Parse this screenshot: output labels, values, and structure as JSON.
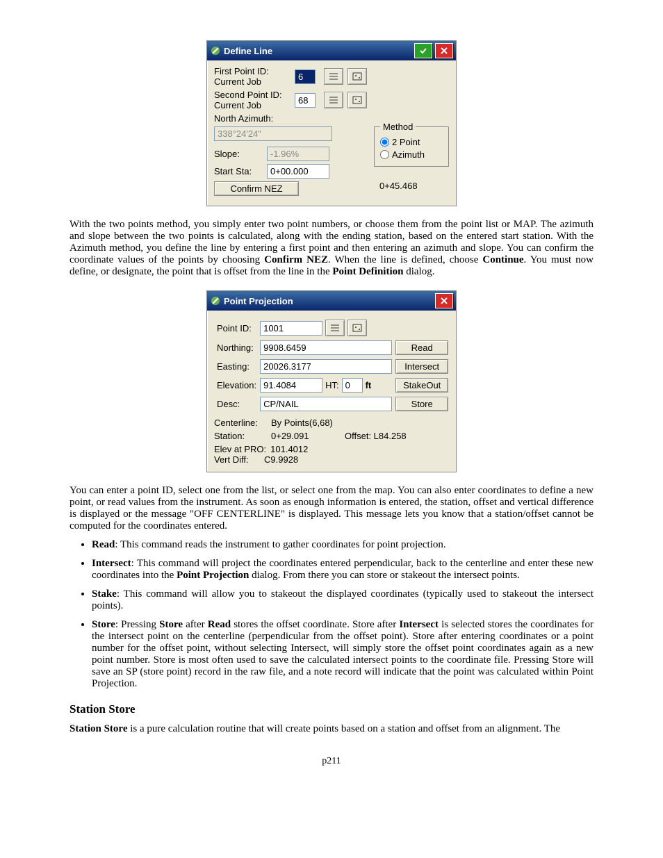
{
  "dialog1": {
    "title": "Define Line",
    "first_label": "First Point ID:",
    "first_sub": "Current Job",
    "first_value": "6",
    "second_label": "Second Point ID:",
    "second_sub": "Current Job",
    "second_value": "68",
    "north_az_label": "North Azimuth:",
    "north_az_value": "338°24'24\"",
    "slope_label": "Slope:",
    "slope_value": "-1.96%",
    "start_sta_label": "Start Sta:",
    "start_sta_value": "0+00.000",
    "end_sta_value": "0+45.468",
    "confirm_btn": "Confirm NEZ",
    "method_legend": "Method",
    "method_opt1": "2 Point",
    "method_opt2": "Azimuth"
  },
  "para1": {
    "p1": "With the two points method, you simply enter two point numbers, or choose them from the point list or MAP.  The azimuth and slope between the two points is calculated, along with the ending station, based on the entered start station.  With the Azimuth method, you define the line by entering a first point and then entering an azimuth and slope. You can confirm the coordinate values of the points by choosing ",
    "b1": "Confirm NEZ",
    "p2": ".  When the line is defined, choose ",
    "b2": "Continue",
    "p3": ".  You must now define, or designate, the point that is offset from the line in the ",
    "b3": "Point Definition",
    "p4": " dialog."
  },
  "dialog2": {
    "title": "Point Projection",
    "point_id_label": "Point ID:",
    "point_id_value": "1001",
    "northing_label": "Northing:",
    "northing_value": "9908.6459",
    "easting_label": "Easting:",
    "easting_value": "20026.3177",
    "elevation_label": "Elevation:",
    "elevation_value": "91.4084",
    "ht_label": "HT:",
    "ht_value": "0",
    "ht_unit": "ft",
    "desc_label": "Desc:",
    "desc_value": "CP/NAIL",
    "read_btn": "Read",
    "intersect_btn": "Intersect",
    "stakeout_btn": "StakeOut",
    "store_btn": "Store",
    "centerline_label": "Centerline:",
    "centerline_value": "By Points(6,68)",
    "station_label": "Station:",
    "station_value": "0+29.091",
    "offset_label": "Offset: L84.258",
    "elev_pro_label": "Elev at PRO:",
    "elev_pro_value": "101.4012",
    "vert_diff_label": "Vert Diff:",
    "vert_diff_value": "C9.9928"
  },
  "para2": "You can enter a point ID, select one from the list, or select one from the map. You can also enter coordinates to define a new point, or read values from the instrument.  As soon as enough information is entered, the station, offset and vertical difference is displayed or the message \"OFF CENTERLINE\" is displayed.  This message lets you know that a station/offset cannot be computed for the coordinates entered.",
  "bullets": {
    "b1_t": "Read",
    "b1_d": ": This command reads the instrument to gather coordinates for point projection.",
    "b2_t": "Intersect",
    "b2_d1": ": This command will project the coordinates entered perpendicular, back to the centerline and enter these new coordinates into the ",
    "b2_b": "Point Projection",
    "b2_d2": " dialog. From there you can store or stakeout the intersect points.",
    "b3_t": "Stake",
    "b3_d": ": This command will allow you to stakeout the displayed coordinates (typically used to stakeout the intersect points).",
    "b4_t": "Store",
    "b4_d1": ": Pressing ",
    "b4_b1": "Store",
    "b4_d2": " after ",
    "b4_b2": "Read",
    "b4_d3": " stores the offset coordinate.  Store after ",
    "b4_b3": "Intersect",
    "b4_d4": " is selected stores the coordinates for the intersect point on the centerline (perpendicular from the offset point).  Store after entering coordinates or a point number for the offset point, without selecting Intersect, will simply store the offset point coordinates again as a new point number.  Store is most often used to save the calculated intersect points to the coordinate file.  Pressing Store will save an SP (store point) record in the raw file, and a note record will indicate that the point was calculated within Point Projection."
  },
  "h_station_store": "Station Store",
  "para3_b": "Station Store",
  "para3": " is a pure calculation routine that will create points based on a station and offset from an alignment.  The",
  "page_num": "p211"
}
